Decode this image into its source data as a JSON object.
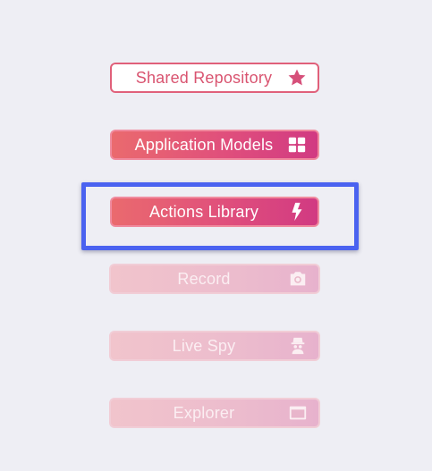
{
  "menu": {
    "items": [
      {
        "label": "Shared Repository",
        "icon": "star-icon",
        "state": "outlined"
      },
      {
        "label": "Application Models",
        "icon": "grid-icon",
        "state": "active"
      },
      {
        "label": "Actions Library",
        "icon": "lightning-icon",
        "state": "active-selected"
      },
      {
        "label": "Record",
        "icon": "camera-icon",
        "state": "disabled"
      },
      {
        "label": "Live Spy",
        "icon": "spy-icon",
        "state": "disabled"
      },
      {
        "label": "Explorer",
        "icon": "window-icon",
        "state": "disabled"
      }
    ]
  },
  "colors": {
    "background": "#eeeef4",
    "accent": "#e04f7c",
    "highlight_border": "#4a62f0",
    "disabled_fill": "#ecbccd"
  }
}
